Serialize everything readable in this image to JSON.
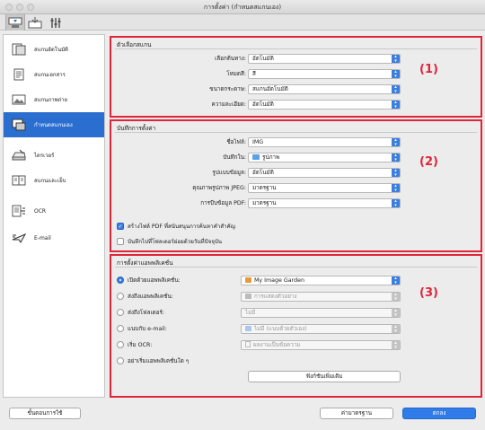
{
  "window": {
    "title": "การตั้งค่า (กำหนดสแกนเอง)"
  },
  "toolbar": {
    "tabs": [
      "scan-from-computer",
      "scan-from-operation-panel",
      "general-settings"
    ]
  },
  "sidebar": {
    "items": [
      {
        "label": "สแกนอัตโนมัติ",
        "icon": "auto-scan-icon"
      },
      {
        "label": "สแกนเอกสาร",
        "icon": "document-icon"
      },
      {
        "label": "สแกนภาพถ่าย",
        "icon": "photo-icon"
      },
      {
        "label": "กำหนดสแกนเอง",
        "icon": "custom-scan-icon"
      },
      {
        "label": "ไดรเวอร์",
        "icon": "driver-icon"
      },
      {
        "label": "สแกนและเย็บ",
        "icon": "stitch-icon"
      },
      {
        "label": "OCR",
        "icon": "ocr-icon"
      },
      {
        "label": "E-mail",
        "icon": "email-icon"
      }
    ],
    "active_index": 3
  },
  "scan_options": {
    "title": "ตัวเลือกสแกน",
    "number": "(1)",
    "rows": [
      {
        "label": "เลือกต้นทาง:",
        "value": "อัตโนมัติ"
      },
      {
        "label": "โหมดสี:",
        "value": "สี"
      },
      {
        "label": "ขนาดกระดาษ:",
        "value": "สแกนอัตโนมัติ"
      },
      {
        "label": "ความละเอียด:",
        "value": "อัตโนมัติ"
      }
    ]
  },
  "save_settings": {
    "title": "บันทึกการตั้งค่า",
    "number": "(2)",
    "rows": [
      {
        "label": "ชื่อไฟล์:",
        "value": "IMG"
      },
      {
        "label": "บันทึกใน:",
        "value": "รูปภาพ",
        "has_folder": true
      },
      {
        "label": "รูปแบบข้อมูล:",
        "value": "อัตโนมัติ"
      },
      {
        "label": "คุณภาพรูปภาพ JPEG:",
        "value": "มาตรฐาน"
      },
      {
        "label": "การบีบข้อมูล PDF:",
        "value": "มาตรฐาน"
      }
    ],
    "checks": [
      {
        "label": "สร้างไฟล์ PDF ที่สนับสนุนการค้นหาคำสำคัญ",
        "checked": true
      },
      {
        "label": "บันทึกไปที่โฟลเดอร์ย่อยด้วยวันที่ปัจจุบัน",
        "checked": false
      }
    ]
  },
  "app_settings": {
    "title": "การตั้งค่าแอพพลิเคชั่น",
    "number": "(3)",
    "rows": [
      {
        "label": "เปิดด้วยแอพพลิเคชั่น:",
        "value": "My Image Garden",
        "selected": true,
        "disabled": false
      },
      {
        "label": "ส่งถึงแอพพลิเคชั่น:",
        "value": "การแสดงตัวอย่าง",
        "selected": false,
        "disabled": true
      },
      {
        "label": "ส่งถึงโฟลเดอร์:",
        "value": "ไม่มี",
        "selected": false,
        "disabled": true
      },
      {
        "label": "แนบกับ e-mail:",
        "value": "ไม่มี (แนบด้วยตัวเอง)",
        "selected": false,
        "disabled": true
      },
      {
        "label": "เริ่ม OCR:",
        "value": "ผลงานเป็นข้อความ",
        "selected": false,
        "disabled": true
      },
      {
        "label": "อย่าเริ่มแอพพลิเคชั่นใด ๆ",
        "selected": false
      }
    ],
    "more_functions": "ฟังก์ชันเพิ่มเติม"
  },
  "footer": {
    "instructions": "ขั้นตอนการใช้",
    "defaults": "ค่ามาตรฐาน",
    "ok": "ตกลง"
  },
  "colors": {
    "accent": "#2f7be8",
    "highlight": "#e0243a",
    "sidebar_active": "#2a6fd0"
  }
}
